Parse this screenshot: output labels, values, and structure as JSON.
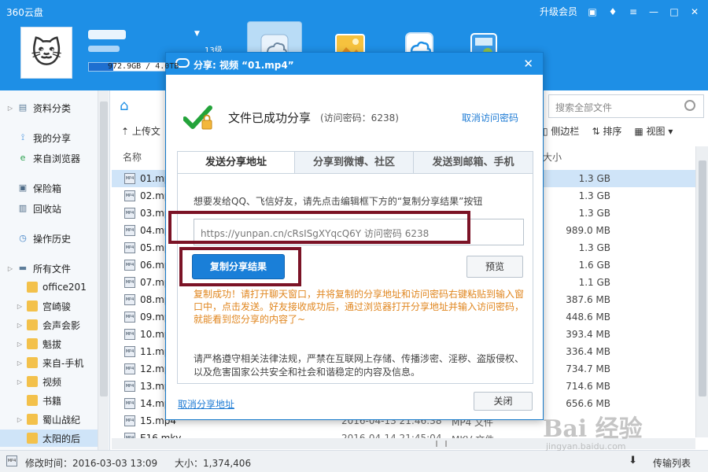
{
  "app": {
    "title": "360云盘",
    "upgrade_label": "升级会员",
    "level": "13级"
  },
  "user": {
    "storage_label": "972.9GB / 4.0TB",
    "storage_used_fraction": 0.24
  },
  "search": {
    "placeholder": "搜索全部文件"
  },
  "toolbar": {
    "upload_label": "上传文",
    "sidebar_toggle": "侧边栏",
    "sort_label": "排序",
    "view_label": "视图"
  },
  "columns": {
    "name": "名称",
    "size": "大小"
  },
  "sidebar": {
    "items": [
      {
        "label": "资料分类",
        "icon": "category-icon",
        "expand": true
      },
      {
        "label": "我的分享",
        "icon": "share-icon",
        "expand": false
      },
      {
        "label": "来自浏览器",
        "icon": "browser-icon",
        "expand": false
      },
      {
        "label": "保险箱",
        "icon": "safe-icon",
        "expand": false
      },
      {
        "label": "回收站",
        "icon": "recycle-icon",
        "expand": false
      },
      {
        "label": "操作历史",
        "icon": "history-icon",
        "expand": false
      },
      {
        "label": "所有文件",
        "icon": "all-files-icon",
        "expand": true
      }
    ],
    "folders": [
      {
        "label": "office201",
        "expand": false
      },
      {
        "label": "宫崎骏",
        "expand": true
      },
      {
        "label": "会声会影",
        "expand": true
      },
      {
        "label": "魁拔",
        "expand": true
      },
      {
        "label": "来自-手机",
        "expand": true
      },
      {
        "label": "视频",
        "expand": true
      },
      {
        "label": "书籍",
        "expand": false
      },
      {
        "label": "蜀山战纪",
        "expand": true
      },
      {
        "label": "太阳的后",
        "expand": false
      }
    ]
  },
  "files": [
    {
      "name": "01.mp",
      "size": "1.3 GB",
      "date": "",
      "type": "",
      "selected": true
    },
    {
      "name": "02.mp",
      "size": "1.3 GB",
      "date": "",
      "type": ""
    },
    {
      "name": "03.mp",
      "size": "1.3 GB",
      "date": "",
      "type": ""
    },
    {
      "name": "04.mp",
      "size": "989.0 MB",
      "date": "",
      "type": ""
    },
    {
      "name": "05.mp",
      "size": "1.3 GB",
      "date": "",
      "type": ""
    },
    {
      "name": "06.mp",
      "size": "1.6 GB",
      "date": "",
      "type": ""
    },
    {
      "name": "07.mp",
      "size": "1.1 GB",
      "date": "",
      "type": ""
    },
    {
      "name": "08.mp",
      "size": "387.6 MB",
      "date": "",
      "type": ""
    },
    {
      "name": "09.mp",
      "size": "448.6 MB",
      "date": "",
      "type": ""
    },
    {
      "name": "10.mp",
      "size": "393.4 MB",
      "date": "",
      "type": ""
    },
    {
      "name": "11.mp",
      "size": "336.4 MB",
      "date": "",
      "type": ""
    },
    {
      "name": "12.mp",
      "size": "734.7 MB",
      "date": "",
      "type": ""
    },
    {
      "name": "13.mp",
      "size": "714.6 MB",
      "date": "",
      "type": ""
    },
    {
      "name": "14.mp",
      "size": "656.6 MB",
      "date": "",
      "type": ""
    },
    {
      "name": "15.mp4",
      "size": "",
      "date": "2016-04-13 21:46:38",
      "type": "MP4 文件"
    },
    {
      "name": "E16.mkv",
      "size": "",
      "date": "2016-04-14 21:45:04",
      "type": "MKV 文件"
    }
  ],
  "status": {
    "modified": "修改时间：2016-03-03 13:09",
    "size": "大小：1,374,406",
    "transfer": "传输列表"
  },
  "dialog": {
    "title": "分享: 视频  “01.mp4”",
    "success_title": "文件已成功分享",
    "access_code_text": "(访问密码：6238)",
    "cancel_code_link": "取消访问密码",
    "tabs": [
      "发送分享地址",
      "分享到微博、社区",
      "发送到邮箱、手机"
    ],
    "instruction": "想要发给QQ、飞信好友，请先点击编辑框下方的“复制分享结果”按钮",
    "link_value": "https://yunpan.cn/cRsISgXYqcQ6Y  访问密码 6238",
    "copy_button": "复制分享结果",
    "preview_button": "预览",
    "success_note": "复制成功！请打开聊天窗口，并将复制的分享地址和访问密码右键粘贴到输入窗口中，点击发送。好友接收成功后，通过浏览器打开分享地址并输入访问密码，就能看到您分享的内容了~",
    "legal_note": "请严格遵守相关法律法规，严禁在互联网上存储、传播涉密、淫秽、盗版侵权、以及危害国家公共安全和社会和谐稳定的内容及信息。",
    "cancel_share_link": "取消分享地址",
    "close_button": "关闭"
  },
  "watermark": {
    "text": "Bai 经验",
    "url": "jingyan.baidu.com"
  },
  "colors": {
    "brand": "#1e8fe6",
    "highlight": "#7b1326",
    "note": "#e0861f",
    "link": "#1e7bd4"
  }
}
